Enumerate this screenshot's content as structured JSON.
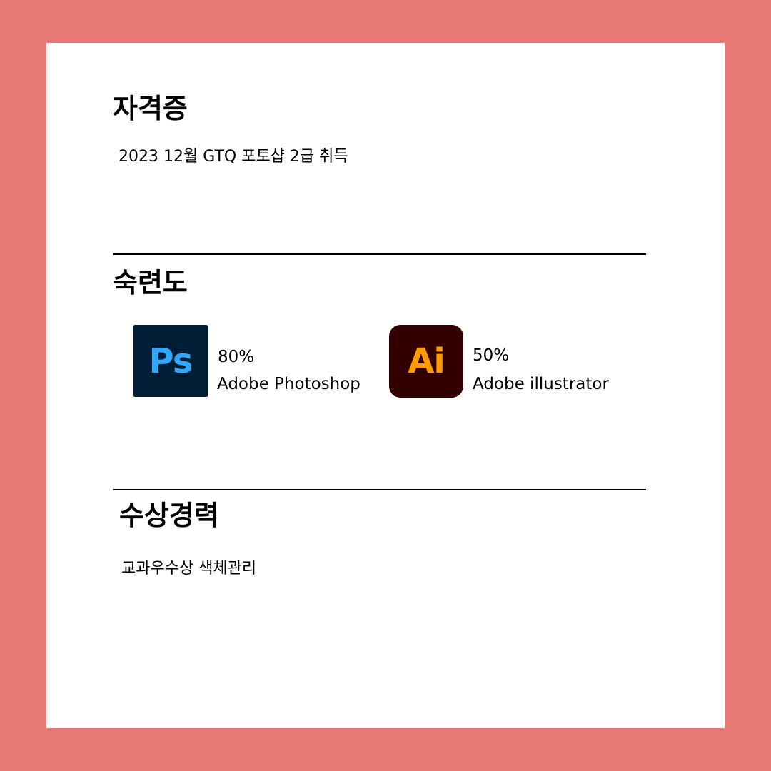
{
  "colors": {
    "background": "#e87876",
    "card": "#ffffff",
    "text": "#000000",
    "photoshop_bg": "#001e36",
    "photoshop_fg": "#31a8ff",
    "illustrator_bg": "#330000",
    "illustrator_fg": "#ff9a00"
  },
  "certificates": {
    "title": "자격증",
    "items": [
      "2023 12월 GTQ 포토샵 2급 취득"
    ]
  },
  "proficiency": {
    "title": "숙련도",
    "skills": [
      {
        "icon": "adobe-photoshop-icon",
        "icon_text": "Ps",
        "level": "80%",
        "name": "Adobe Photoshop"
      },
      {
        "icon": "adobe-illustrator-icon",
        "icon_text": "Ai",
        "level": "50%",
        "name": "Adobe illustrator"
      }
    ]
  },
  "awards": {
    "title": "수상경력",
    "items": [
      "교과우수상 색체관리"
    ]
  }
}
